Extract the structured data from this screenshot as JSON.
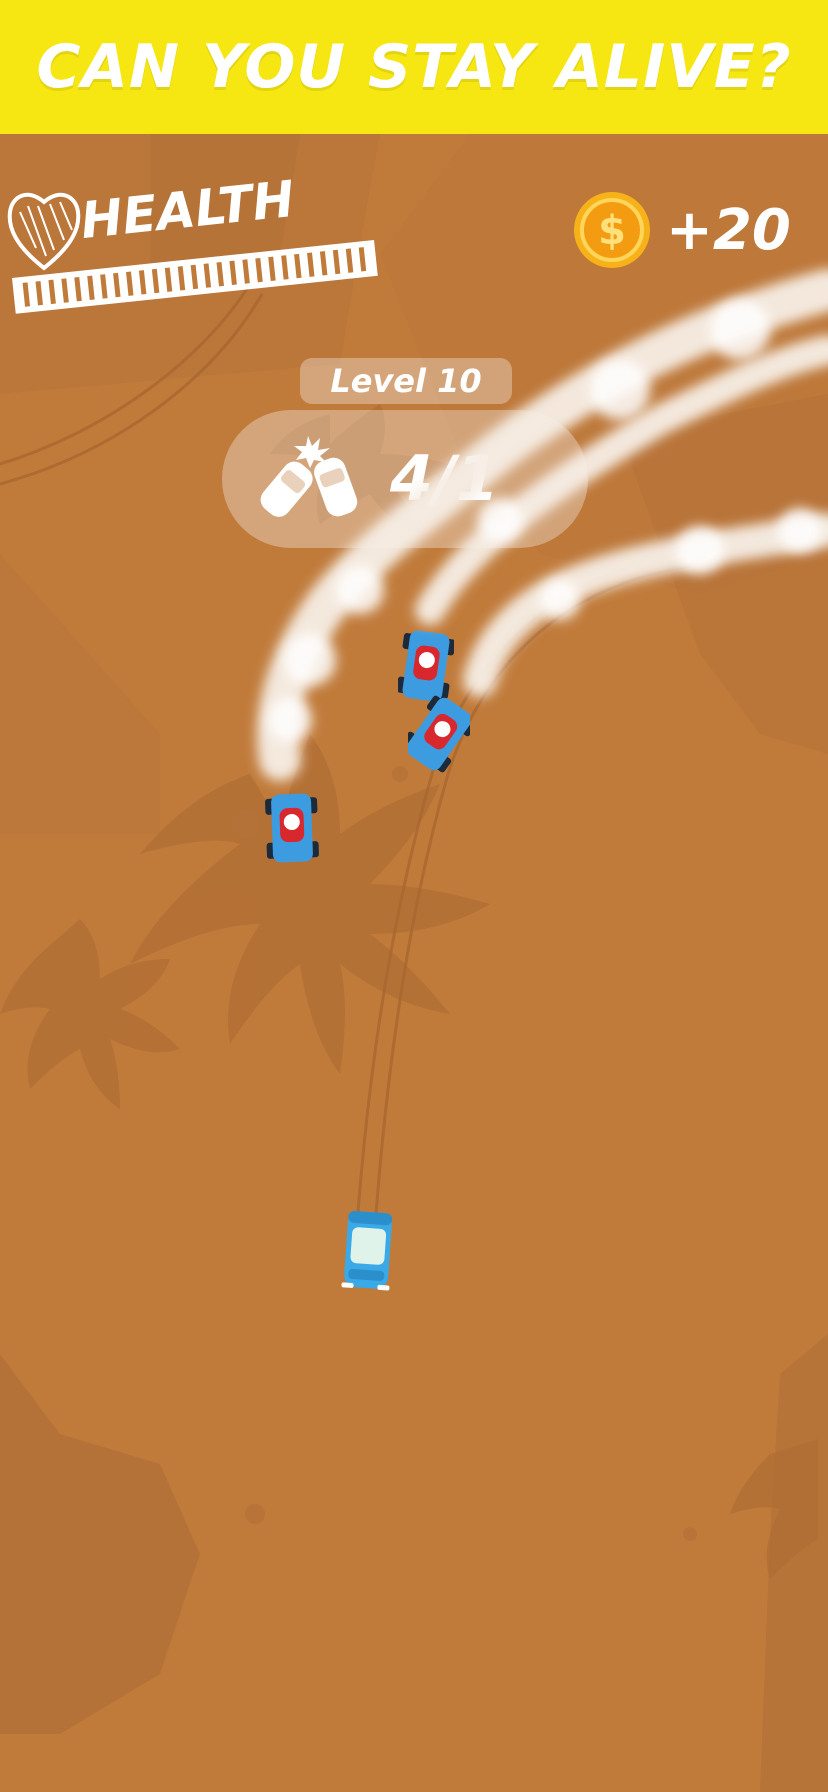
{
  "banner": {
    "text": "CAN YOU STAY ALIVE?"
  },
  "health": {
    "label": "HEALTH",
    "icon": "heart-icon"
  },
  "coins": {
    "icon": "dollar-coin-icon",
    "amount": "+20"
  },
  "level": {
    "label": "Level 10"
  },
  "progress": {
    "icon": "car-crash-icon",
    "text": "4/1"
  },
  "colors": {
    "banner": "#f6e612",
    "ground": "#c07b3b",
    "kart_body": "#3d9be0",
    "kart_driver": "#d8272d",
    "player_car": "#3aa9e8",
    "coin": "#f7b21a"
  }
}
